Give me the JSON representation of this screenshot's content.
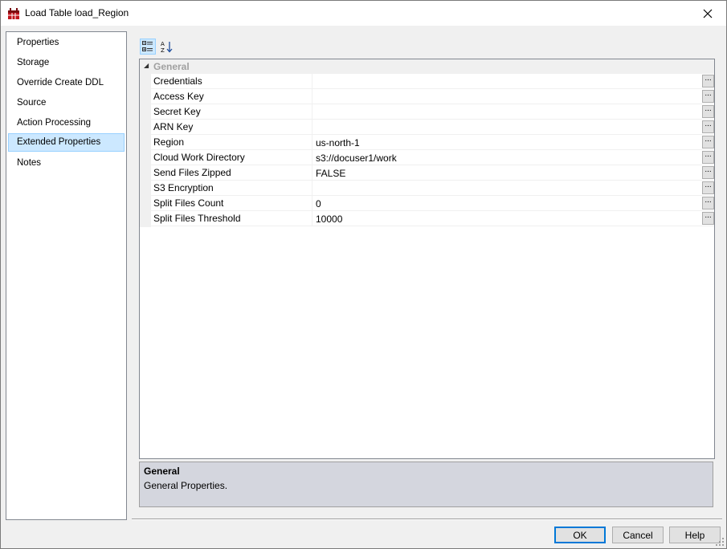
{
  "window": {
    "title": "Load Table load_Region"
  },
  "nav": {
    "items": [
      {
        "label": "Properties"
      },
      {
        "label": "Storage"
      },
      {
        "label": "Override Create DDL"
      },
      {
        "label": "Source"
      },
      {
        "label": "Action Processing"
      },
      {
        "label": "Extended Properties",
        "selected": true
      },
      {
        "label": "Notes"
      }
    ]
  },
  "toolbar": {
    "categorized_icon": "categorized-view-icon",
    "alphabetical_icon": "sort-alphabetical-icon"
  },
  "grid": {
    "category": "General",
    "rows": [
      {
        "name": "Credentials",
        "value": "",
        "button": "..."
      },
      {
        "name": "Access Key",
        "value": "",
        "button": "..."
      },
      {
        "name": "Secret Key",
        "value": "",
        "button": "..."
      },
      {
        "name": "ARN Key",
        "value": "",
        "button": "..."
      },
      {
        "name": "Region",
        "value": "us-north-1",
        "button": "..."
      },
      {
        "name": "Cloud Work Directory",
        "value": "s3://docuser1/work",
        "button": "..."
      },
      {
        "name": "Send Files Zipped",
        "value": "FALSE",
        "button": "..."
      },
      {
        "name": "S3 Encryption",
        "value": "",
        "button": "..."
      },
      {
        "name": "Split Files Count",
        "value": "0",
        "button": "..."
      },
      {
        "name": "Split Files Threshold",
        "value": "10000",
        "button": "..."
      }
    ]
  },
  "help": {
    "title": "General",
    "description": "General Properties."
  },
  "buttons": {
    "ok": "OK",
    "cancel": "Cancel",
    "help": "Help"
  },
  "colors": {
    "selection": "#cce8ff",
    "selection_border": "#99d1ff",
    "default_button_border": "#0078d7",
    "help_pane": "#d4d6de"
  }
}
